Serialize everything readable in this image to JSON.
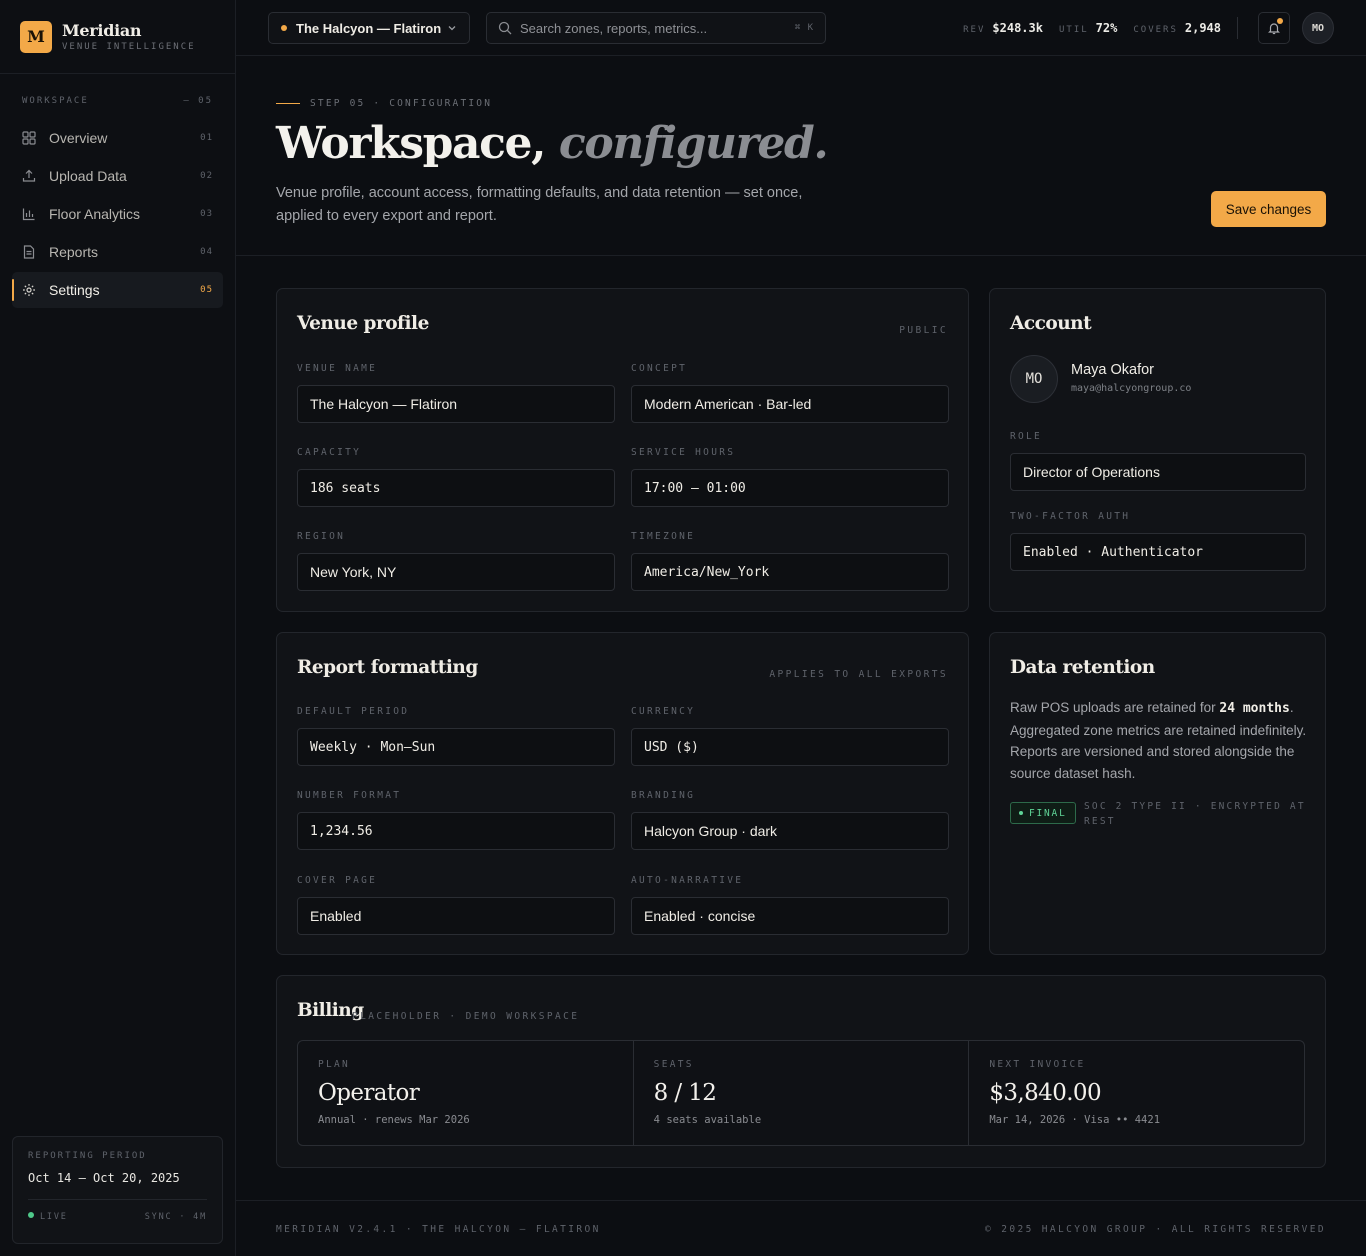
{
  "brand": {
    "logo_letter": "M",
    "name": "Meridian",
    "subtitle": "VENUE INTELLIGENCE"
  },
  "sidebar": {
    "section_label": "WORKSPACE",
    "section_count": "— 05",
    "items": [
      {
        "label": "Overview",
        "num": "01",
        "icon": "grid-icon",
        "active": false
      },
      {
        "label": "Upload Data",
        "num": "02",
        "icon": "upload-icon",
        "active": false
      },
      {
        "label": "Floor Analytics",
        "num": "03",
        "icon": "bar-chart-icon",
        "active": false
      },
      {
        "label": "Reports",
        "num": "04",
        "icon": "document-icon",
        "active": false
      },
      {
        "label": "Settings",
        "num": "05",
        "icon": "gear-icon",
        "active": true
      }
    ],
    "period": {
      "label": "REPORTING PERIOD",
      "value": "Oct 14 – Oct 20, 2025",
      "status": "LIVE",
      "sync": "SYNC · 4M"
    }
  },
  "topbar": {
    "venue": "The Halcyon — Flatiron",
    "search_placeholder": "Search zones, reports, metrics...",
    "search_shortcut": "⌘ K",
    "metrics": [
      {
        "label": "REV",
        "value": "$248.3k"
      },
      {
        "label": "UTIL",
        "value": "72%"
      },
      {
        "label": "COVERS",
        "value": "2,948"
      }
    ],
    "avatar": "MO"
  },
  "hero": {
    "step": "STEP 05 · CONFIGURATION",
    "title_main": "Workspace,",
    "title_em": "configured.",
    "desc": "Venue profile, account access, formatting defaults, and data retention — set once, applied to every export and report.",
    "save_label": "Save changes"
  },
  "venue_profile": {
    "title": "Venue profile",
    "tag": "PUBLIC",
    "fields": [
      {
        "label": "VENUE NAME",
        "value": "The Halcyon — Flatiron"
      },
      {
        "label": "CONCEPT",
        "value": "Modern American · Bar-led"
      },
      {
        "label": "CAPACITY",
        "value": "186 seats"
      },
      {
        "label": "SERVICE HOURS",
        "value": "17:00 – 01:00"
      },
      {
        "label": "REGION",
        "value": "New York, NY"
      },
      {
        "label": "TIMEZONE",
        "value": "America/New_York"
      }
    ]
  },
  "account": {
    "title": "Account",
    "initials": "MO",
    "name": "Maya Okafor",
    "email": "maya@halcyongroup.co",
    "role_label": "ROLE",
    "role": "Director of Operations",
    "tfa_label": "TWO-FACTOR AUTH",
    "tfa": "Enabled · Authenticator"
  },
  "report_formatting": {
    "title": "Report formatting",
    "tag": "APPLIES TO ALL EXPORTS",
    "fields": [
      {
        "label": "DEFAULT PERIOD",
        "value": "Weekly · Mon–Sun"
      },
      {
        "label": "CURRENCY",
        "value": "USD ($)"
      },
      {
        "label": "NUMBER FORMAT",
        "value": "1,234.56"
      },
      {
        "label": "BRANDING",
        "value": "Halcyon Group · dark"
      },
      {
        "label": "COVER PAGE",
        "value": "Enabled"
      },
      {
        "label": "AUTO-NARRATIVE",
        "value": "Enabled · concise"
      }
    ]
  },
  "retention": {
    "title": "Data retention",
    "text_1": "Raw POS uploads are retained for ",
    "months": "24 months",
    "text_2": ". Aggregated zone metrics are retained indefinitely. Reports are versioned and stored alongside the source dataset hash.",
    "badge": "FINAL",
    "compliance": "SOC 2 TYPE II · ENCRYPTED AT REST"
  },
  "billing": {
    "title": "Billing",
    "tag": "PLACEHOLDER · DEMO WORKSPACE",
    "cells": [
      {
        "label": "PLAN",
        "value": "Operator",
        "sub": "Annual · renews Mar 2026"
      },
      {
        "label": "SEATS",
        "value": "8 / 12",
        "sub": "4 seats available"
      },
      {
        "label": "NEXT INVOICE",
        "value": "$3,840.00",
        "sub": "Mar 14, 2026 · Visa •• 4421"
      }
    ]
  },
  "footer": {
    "left": "MERIDIAN V2.4.1 · THE HALCYON — FLATIRON",
    "right": "© 2025 HALCYON GROUP · ALL RIGHTS RESERVED"
  },
  "colors": {
    "accent": "#f3a948",
    "success": "#5fd497",
    "background": "#0c0e12",
    "card": "#111317"
  }
}
